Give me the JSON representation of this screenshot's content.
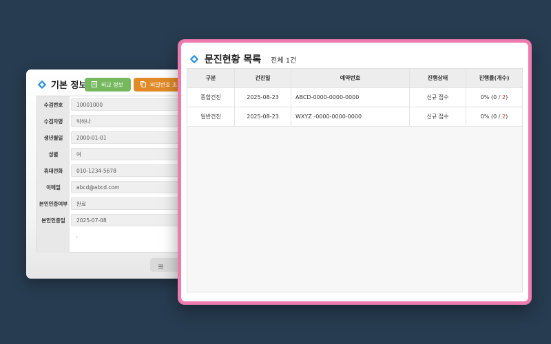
{
  "info_card": {
    "title": "기본 정보",
    "compare_button": "비교 정보",
    "password_button": "비밀번호 초",
    "rows": [
      {
        "label": "수검번호",
        "value": "10001000"
      },
      {
        "label": "수검자명",
        "value": "박하나"
      },
      {
        "label": "생년월일",
        "value": "2000-01-01"
      },
      {
        "label": "성별",
        "value": "여"
      },
      {
        "label": "휴대전화",
        "value": "010-1234-5678"
      },
      {
        "label": "이메일",
        "value": "abcd@abcd.com"
      },
      {
        "label": "본인인증여부",
        "value": "완료"
      },
      {
        "label": "본인인증일",
        "value": "2025-07-08"
      },
      {
        "label": "",
        "value": "-"
      }
    ]
  },
  "list_card": {
    "title": "문진현황 목록",
    "count": "전체 1건",
    "headers": [
      "구분",
      "건진일",
      "예약번호",
      "진행상태",
      "진행률(개수)"
    ],
    "rows": [
      {
        "type": "종합건진",
        "date": "2025-08-23",
        "reservation": "ABCD-0000-0000-0000",
        "status": "신규 접수",
        "progress_prefix": "0% (0 / ",
        "progress_total": "2",
        "progress_suffix": ")"
      },
      {
        "type": "일반건진",
        "date": "2025-08-23",
        "reservation": "WXYZ -0000-0000-0000",
        "status": "신규 접수",
        "progress_prefix": "0% (0 / ",
        "progress_total": "2",
        "progress_suffix": ")"
      }
    ]
  },
  "colors": {
    "background": "#273c50",
    "accent_border": "#ee7bb0",
    "diamond_icon": "#2a8fd8",
    "compare_button": "#76b85e",
    "password_button": "#e08a28",
    "progress_total": "#d62d2d"
  },
  "icons": {
    "title_icon": "diamond-icon",
    "compare_icon": "document-icon",
    "password_icon": "copy-icon",
    "pager_icon": "list-icon"
  }
}
